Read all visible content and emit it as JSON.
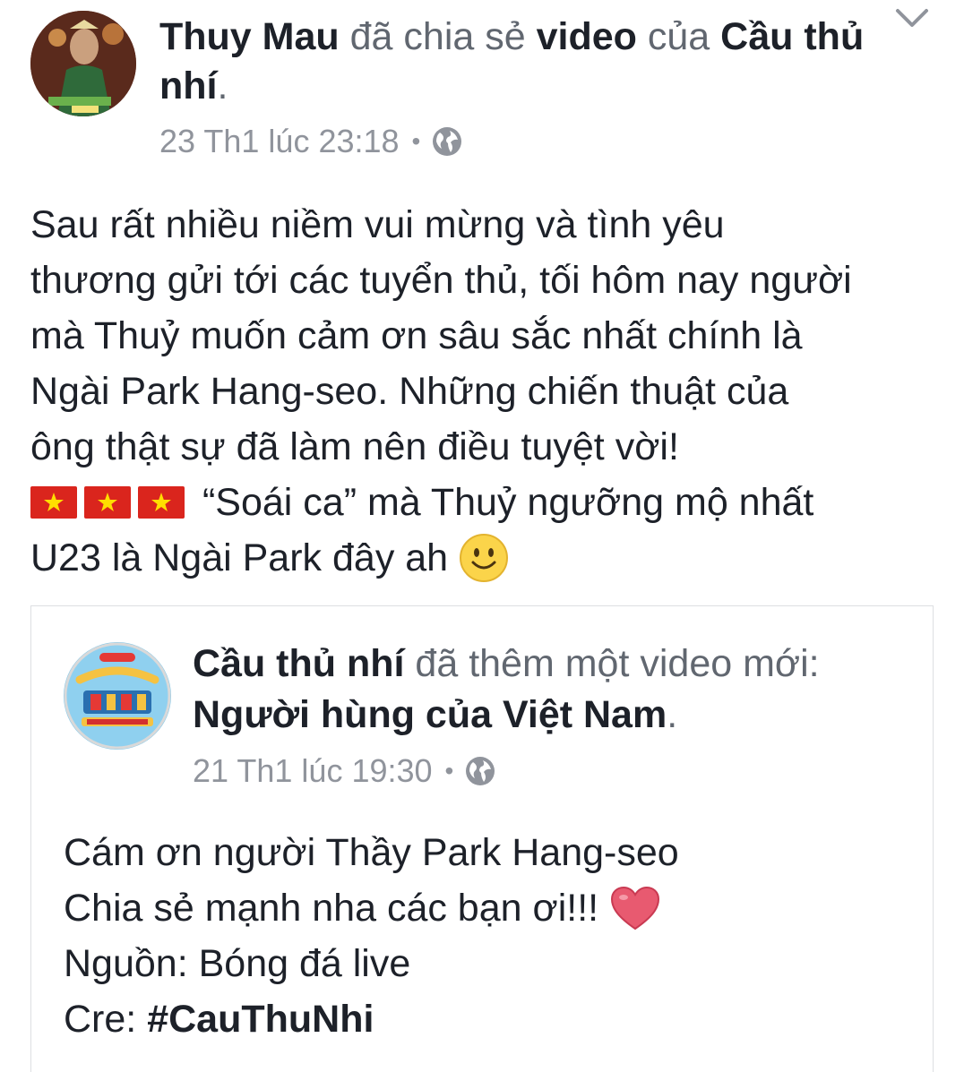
{
  "post": {
    "author": "Thuy Mau",
    "action_text": "đã chia sẻ",
    "object_text": "video",
    "of_text": "của",
    "source_page": "Cầu thủ nhí",
    "period": ".",
    "timestamp": "23 Th1 lúc 23:18",
    "separator": "•",
    "privacy_icon": "globe-icon",
    "body_lines": [
      "Sau rất nhiều niềm vui mừng và tình yêu",
      "thương gửi tới các tuyển thủ, tối hôm nay người",
      "mà Thuỷ muốn cảm ơn sâu sắc nhất chính là",
      "Ngài Park Hang-seo. Những chiến thuật của",
      "ông thật sự đã làm nên điều tuyệt vời!"
    ],
    "flag_line_text": "“Soái ca” mà Thuỷ ngưỡng mộ nhất",
    "last_line_text": "U23 là Ngài Park đây ah",
    "menu_icon": "chevron-down-icon"
  },
  "shared_post": {
    "page_name": "Cầu thủ nhí",
    "action_text": "đã thêm một video mới:",
    "video_title": "Người hùng của Việt Nam",
    "period": ".",
    "timestamp": "21 Th1 lúc 19:30",
    "separator": "•",
    "privacy_icon": "globe-icon",
    "line1": "Cám ơn người Thầy Park Hang-seo",
    "line2": "Chia sẻ mạnh nha các bạn ơi!!!",
    "line3": "Nguồn: Bóng đá live",
    "cre_label": "Cre:",
    "hashtag": "#CauThuNhi"
  },
  "colors": {
    "text": "#1d2129",
    "muted": "#616770",
    "meta": "#90949c",
    "flag_red": "#da251d",
    "star_yellow": "#ffde00",
    "heart": "#e85a70"
  }
}
